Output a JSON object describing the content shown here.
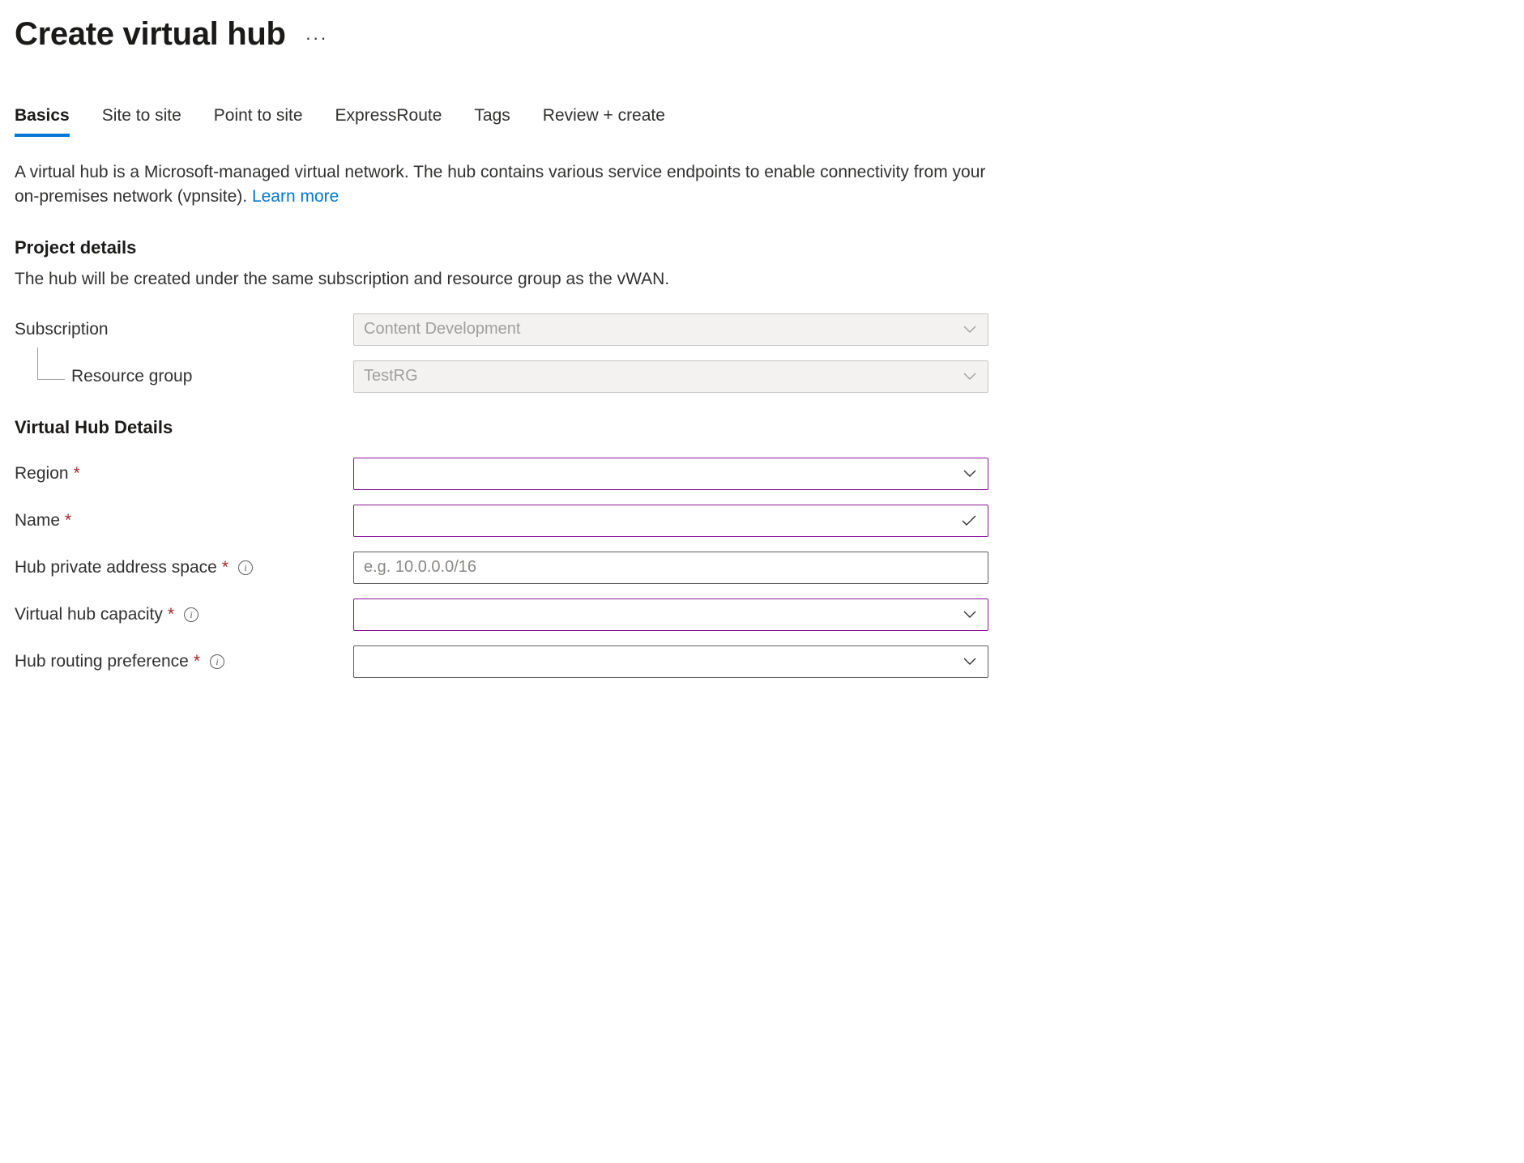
{
  "header": {
    "title": "Create virtual hub",
    "more_label": "···"
  },
  "tabs": {
    "items": [
      {
        "label": "Basics",
        "active": true
      },
      {
        "label": "Site to site",
        "active": false
      },
      {
        "label": "Point to site",
        "active": false
      },
      {
        "label": "ExpressRoute",
        "active": false
      },
      {
        "label": "Tags",
        "active": false
      },
      {
        "label": "Review + create",
        "active": false
      }
    ]
  },
  "intro": {
    "text": "A virtual hub is a Microsoft-managed virtual network. The hub contains various service endpoints to enable connectivity from your on-premises network (vpnsite).  ",
    "link": "Learn more"
  },
  "project_details": {
    "title": "Project details",
    "subtitle": "The hub will be created under the same subscription and resource group as the vWAN.",
    "subscription_label": "Subscription",
    "subscription_value": "Content Development",
    "resource_group_label": "Resource group",
    "resource_group_value": "TestRG"
  },
  "hub_details": {
    "title": "Virtual Hub Details",
    "region_label": "Region",
    "region_value": "",
    "name_label": "Name",
    "name_value": "",
    "address_label": "Hub private address space",
    "address_placeholder": "e.g. 10.0.0.0/16",
    "address_value": "",
    "capacity_label": "Virtual hub capacity",
    "capacity_value": "",
    "routing_label": "Hub routing preference",
    "routing_value": ""
  }
}
